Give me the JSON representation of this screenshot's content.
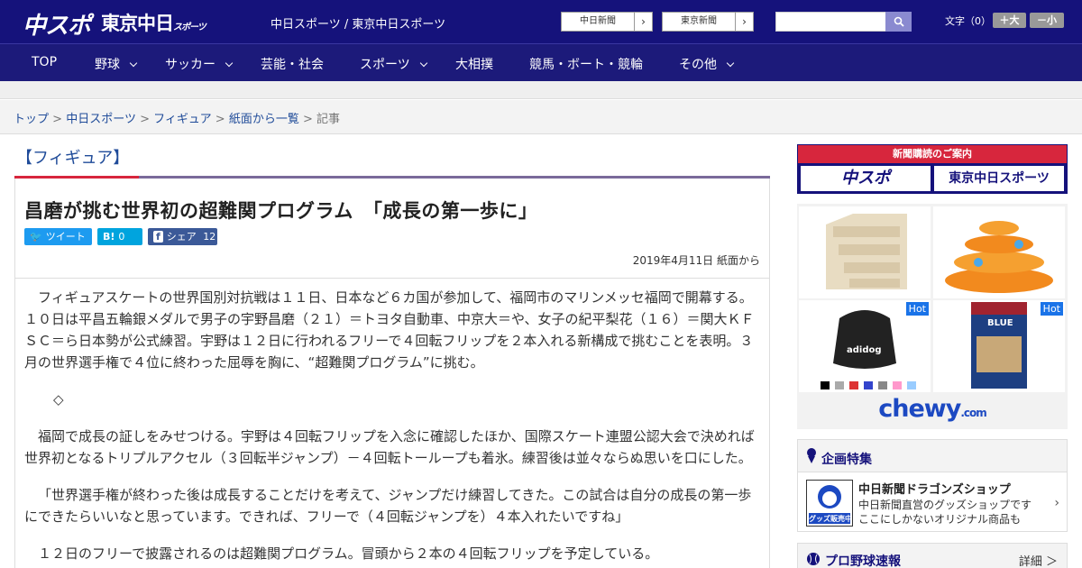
{
  "header": {
    "logo_chusupo": "中スポ",
    "logo_tokyo": "東京中日",
    "logo_tokyo_sub": "スポーツ",
    "site_names": "中日スポーツ / 東京中日スポーツ",
    "paper_buttons": [
      "中日新聞",
      "東京新聞"
    ],
    "search_placeholder": "",
    "font_size_label": "文字（0）",
    "font_plus": "＋大",
    "font_minus": "－小"
  },
  "nav": [
    "TOP",
    "野球",
    "サッカー",
    "芸能・社会",
    "スポーツ",
    "大相撲",
    "競馬・ボート・競輪",
    "その他"
  ],
  "breadcrumb": {
    "items": [
      "トップ",
      "中日スポーツ",
      "フィギュア",
      "紙面から一覧"
    ],
    "current": "記事",
    "sep": ">"
  },
  "article": {
    "category": "【フィギュア】",
    "headline": "昌磨が挑む世界初の超難関プログラム　「成長の第一歩に」",
    "share": {
      "tweet": "ツイート",
      "hatena_icon": "B!",
      "hatena_count": "0",
      "fb_label": "シェア",
      "fb_count": "12"
    },
    "date": "2019年4月11日 紙面から",
    "paragraphs": [
      "フィギュアスケートの世界国別対抗戦は１１日、日本など６カ国が参加して、福岡市のマリンメッセ福岡で開幕する。１０日は平昌五輪銀メダルで男子の宇野昌磨（２１）＝トヨタ自動車、中京大＝や、女子の紀平梨花（１６）＝関大ＫＦＳＣ＝ら日本勢が公式練習。宇野は１２日に行われるフリーで４回転フリップを２本入れる新構成で挑むことを表明。３月の世界選手権で４位に終わった屈辱を胸に、“超難関プログラム”に挑む。",
      "◇",
      "福岡で成長の証しをみせつける。宇野は４回転フリップを入念に確認したほか、国際スケート連盟公認大会で決めれば世界初となるトリプルアクセル（３回転半ジャンプ）－４回転トーループも着氷。練習後は並々ならぬ思いを口にした。",
      "「世界選手権が終わった後は成長することだけを考えて、ジャンプだけ練習してきた。この試合は自分の成長の第一歩にできたらいいなと思っています。できれば、フリーで（４回転ジャンプを）４本入れたいですね」",
      "１２日のフリーで披露されるのは超難関プログラム。冒頭から２本の４回転フリップを予定している。"
    ]
  },
  "sidebar": {
    "subscribe_title": "新聞購読のご案内",
    "subscribe_logos": [
      "中スポ",
      "東京中日スポーツ"
    ],
    "ad": {
      "hot_labels": [
        "Hot",
        "Hot"
      ],
      "brand": "chewy",
      "brand_suffix": ".com",
      "dog_text": "adidog",
      "food_text": "BLUE"
    },
    "special": {
      "title": "企画特集",
      "item_name": "中日新聞ドラゴンズショップ",
      "item_desc1": "中日新聞直営のグッズショップです",
      "item_desc2": "ここにしかないオリジナル商品も",
      "thumb_text": "グッズ販売中"
    },
    "baseball": {
      "title": "プロ野球速報",
      "more": "詳細 ＞"
    }
  },
  "colors": {
    "brand_navy": "#15127b",
    "accent_red": "#d7263d",
    "link_blue": "#1f4b99"
  }
}
